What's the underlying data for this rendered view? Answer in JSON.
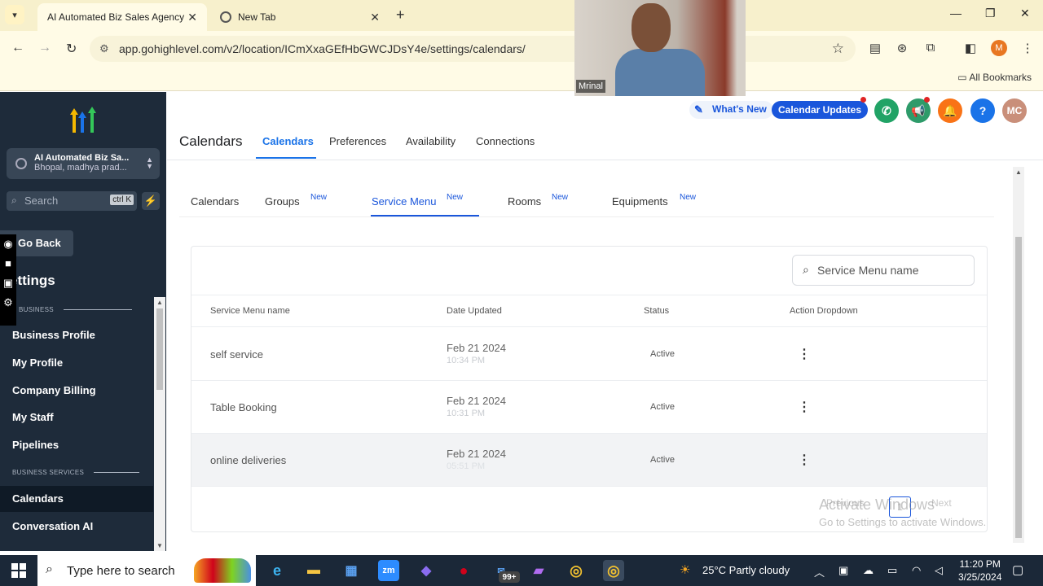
{
  "browser": {
    "tabs": [
      {
        "title": "AI Automated Biz Sales Agency",
        "active": true
      },
      {
        "title": "New Tab",
        "active": false
      }
    ],
    "url": "app.gohighlevel.com/v2/location/ICmXxaGEfHbGWCJDsY4e/settings/calendars/",
    "bookmarks_label": "All Bookmarks",
    "profile_initial": "M"
  },
  "webcam": {
    "name": "Mrinal"
  },
  "sidebar": {
    "account_name": "AI Automated Biz Sa...",
    "account_location": "Bhopal, madhya prad...",
    "search_placeholder": "Search",
    "search_shortcut": "ctrl K",
    "go_back": "Go Back",
    "settings_heading": "ettings",
    "section_my_business": "Y BUSINESS",
    "section_business_services": "BUSINESS SERVICES",
    "items": [
      {
        "label": "Business Profile"
      },
      {
        "label": "My Profile"
      },
      {
        "label": "Company Billing"
      },
      {
        "label": "My Staff"
      },
      {
        "label": "Pipelines"
      },
      {
        "label": "Calendars",
        "active": true
      },
      {
        "label": "Conversation AI"
      }
    ]
  },
  "header": {
    "whats_new": "What's New",
    "calendar_updates": "Calendar Updates",
    "avatar_initials": "MC",
    "help": "?"
  },
  "page": {
    "title": "Calendars",
    "top_tabs": [
      "Calendars",
      "Preferences",
      "Availability",
      "Connections"
    ],
    "active_top_tab": "Calendars",
    "sub_tabs": [
      {
        "label": "Calendars",
        "badge": ""
      },
      {
        "label": "Groups",
        "badge": "New"
      },
      {
        "label": "Service Menu",
        "badge": "New"
      },
      {
        "label": "Rooms",
        "badge": "New"
      },
      {
        "label": "Equipments",
        "badge": "New"
      }
    ],
    "active_sub_tab": "Service Menu",
    "search_placeholder": "Service Menu name"
  },
  "table": {
    "columns": [
      "Service Menu name",
      "Date Updated",
      "Status",
      "Action Dropdown"
    ],
    "rows": [
      {
        "name": "self service",
        "date": "Feb 21 2024",
        "time": "10:34 PM",
        "status": "Active"
      },
      {
        "name": "Table Booking",
        "date": "Feb 21 2024",
        "time": "10:31 PM",
        "status": "Active"
      },
      {
        "name": "online deliveries",
        "date": "Feb 21 2024",
        "time": "05:51 PM",
        "status": "Active"
      }
    ],
    "pagination": {
      "previous": "Previous",
      "page": "1",
      "next": "Next"
    }
  },
  "watermark": {
    "line1": "Activate Windows",
    "line2": "Go to Settings to activate Windows."
  },
  "taskbar": {
    "search_placeholder": "Type here to search",
    "mail_badge": "99+",
    "weather": "25°C  Partly cloudy",
    "time": "11:20 PM",
    "date": "3/25/2024"
  },
  "colors": {
    "accent": "#1a56db",
    "sidebar_bg": "#1e2b3a",
    "phone": "#21a366",
    "bell": "#f97316"
  }
}
